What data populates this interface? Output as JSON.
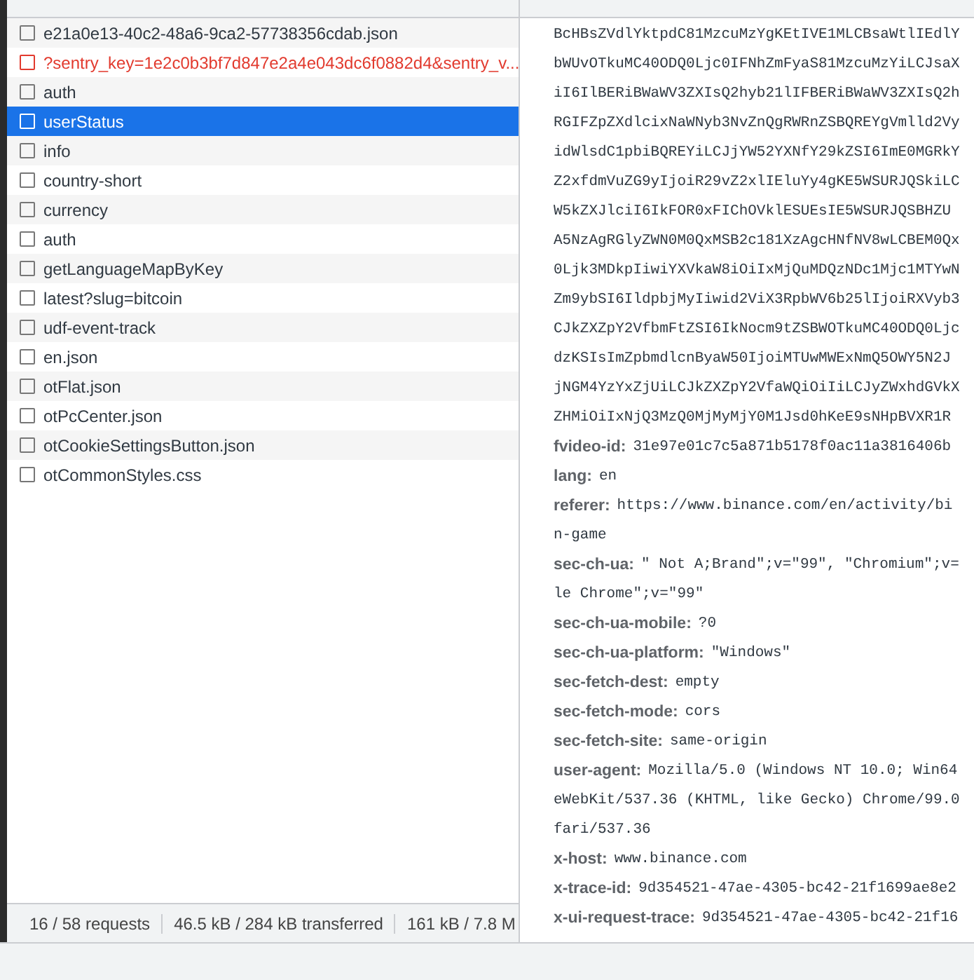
{
  "requests": [
    {
      "name": "e21a0e13-40c2-48a6-9ca2-57738356cdab.json",
      "selected": false,
      "error": false
    },
    {
      "name": "?sentry_key=1e2c0b3bf7d847e2a4e043dc6f0882d4&sentry_v...",
      "selected": false,
      "error": true
    },
    {
      "name": "auth",
      "selected": false,
      "error": false
    },
    {
      "name": "userStatus",
      "selected": true,
      "error": false
    },
    {
      "name": "info",
      "selected": false,
      "error": false
    },
    {
      "name": "country-short",
      "selected": false,
      "error": false
    },
    {
      "name": "currency",
      "selected": false,
      "error": false
    },
    {
      "name": "auth",
      "selected": false,
      "error": false
    },
    {
      "name": "getLanguageMapByKey",
      "selected": false,
      "error": false
    },
    {
      "name": "latest?slug=bitcoin",
      "selected": false,
      "error": false
    },
    {
      "name": "udf-event-track",
      "selected": false,
      "error": false
    },
    {
      "name": "en.json",
      "selected": false,
      "error": false
    },
    {
      "name": "otFlat.json",
      "selected": false,
      "error": false
    },
    {
      "name": "otPcCenter.json",
      "selected": false,
      "error": false
    },
    {
      "name": "otCookieSettingsButton.json",
      "selected": false,
      "error": false
    },
    {
      "name": "otCommonStyles.css",
      "selected": false,
      "error": false
    }
  ],
  "status_bar": [
    "16 / 58 requests",
    "46.5 kB / 284 kB transferred",
    "161 kB / 7.8 M"
  ],
  "headers": [
    {
      "value": "BcHBsZVdlYktpdC81MzcuMzYgKEtIVE1MLCBsaWtlIEdlY"
    },
    {
      "value": "bWUvOTkuMC40ODQ0Ljc0IFNhZmFyaS81MzcuMzYiLCJsaX"
    },
    {
      "value": "iI6IlBERiBWaWV3ZXIsQ2hyb21lIFBERiBWaWV3ZXIsQ2h"
    },
    {
      "value": "RGIFZpZXdlcixNaWNyb3NvZnQgRWRnZSBQREYgVmlld2Vy"
    },
    {
      "value": "idWlsdC1pbiBQREYiLCJjYW52YXNfY29kZSI6ImE0MGRkY"
    },
    {
      "value": "Z2xfdmVuZG9yIjoiR29vZ2xlIEluYy4gKE5WSURJQSkiLC"
    },
    {
      "value": "W5kZXJlciI6IkFOR0xFIChOVklESUEsIE5WSURJQSBHZU"
    },
    {
      "value": "A5NzAgRGlyZWN0M0QxMSB2c181XzAgcHNfNV8wLCBEM0Qx"
    },
    {
      "value": "0Ljk3MDkpIiwiYXVkaW8iOiIxMjQuMDQzNDc1Mjc1MTYwN"
    },
    {
      "value": "Zm9ybSI6IldpbjMyIiwid2ViX3RpbWV6b25lIjoiRXVyb3"
    },
    {
      "value": "CJkZXZpY2VfbmFtZSI6IkNocm9tZSBWOTkuMC40ODQ0Ljc"
    },
    {
      "value": "dzKSIsImZpbmdlcnByaW50IjoiMTUwMWExNmQ5OWY5N2J"
    },
    {
      "value": "jNGM4YzYxZjUiLCJkZXZpY2VfaWQiOiIiLCJyZWxhdGVkX"
    },
    {
      "value": "ZHMiOiIxNjQ3MzQ0MjMyMjY0M1Jsd0hKeE9sNHpBVXR1R"
    },
    {
      "name": "fvideo-id:",
      "value": "31e97e01c7c5a871b5178f0ac11a3816406b"
    },
    {
      "name": "lang:",
      "value": "en"
    },
    {
      "name": "referer:",
      "value": "https://www.binance.com/en/activity/bi"
    },
    {
      "value": "n-game"
    },
    {
      "name": "sec-ch-ua:",
      "value": "\" Not A;Brand\";v=\"99\", \"Chromium\";v="
    },
    {
      "value": "le Chrome\";v=\"99\""
    },
    {
      "name": "sec-ch-ua-mobile:",
      "value": "?0"
    },
    {
      "name": "sec-ch-ua-platform:",
      "value": "\"Windows\""
    },
    {
      "name": "sec-fetch-dest:",
      "value": "empty"
    },
    {
      "name": "sec-fetch-mode:",
      "value": "cors"
    },
    {
      "name": "sec-fetch-site:",
      "value": "same-origin"
    },
    {
      "name": "user-agent:",
      "value": "Mozilla/5.0 (Windows NT 10.0; Win64"
    },
    {
      "value": "eWebKit/537.36 (KHTML, like Gecko) Chrome/99.0"
    },
    {
      "value": "fari/537.36"
    },
    {
      "name": "x-host:",
      "value": "www.binance.com"
    },
    {
      "name": "x-trace-id:",
      "value": "9d354521-47ae-4305-bc42-21f1699ae8e2"
    },
    {
      "name": "x-ui-request-trace:",
      "value": "9d354521-47ae-4305-bc42-21f16"
    }
  ]
}
